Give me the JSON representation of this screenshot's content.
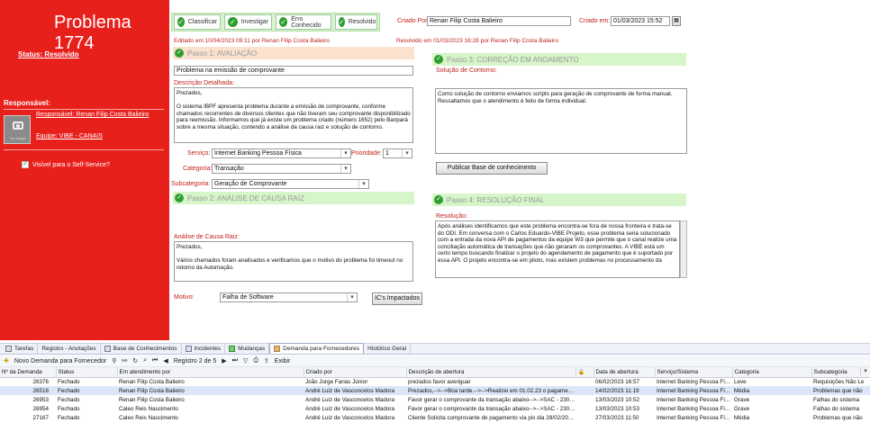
{
  "sidebar": {
    "title": "Problema 1774",
    "status": "Status: Resolvido",
    "responsavel_heading": "Responsável:",
    "no_image": "No Image",
    "responsavel_link": "Responsável: Renan Filip Costa Balieiro",
    "equipe_link": "Equipe: VIBE - CANAIS",
    "self_service_label": "Visível para o Self-Service?"
  },
  "workflow": {
    "tabs": [
      "Classificar",
      "Investigar",
      "Erro Conhecido",
      "Resolvido"
    ]
  },
  "header": {
    "criado_por_label": "Criado Por:",
    "criado_por_value": "Renan Filip Costa Balieiro",
    "criado_em_label": "Criado em:",
    "criado_em_value": "01/03/2023 15:52",
    "editado": "Editado em 10/04/2023 09:11 por Renan Filip Costa Balieiro",
    "resolvido": "Resolvido em 01/03/2023 16:28  por Renan Filip Costa Balieiro"
  },
  "passo1": {
    "title": "Passo 1: AVALIAÇÃO",
    "resumo": "Problema na emissão de comprovante",
    "descricao_label": "Descrição Detalhada:",
    "descricao": "Prezados,\n\nO sistema IBPF apresenta problema durante a emissão de comprovante, conforme chamados recorrentes de diversos clientes que não tiveram seu comprovante disponibilizado para reemissão. Informamos que já existe um problema criado (número 1652) pelo Banpará sobre a mesma situação, contendo a análise da causa raiz e solução de contorno.",
    "servico_label": "Serviço:",
    "servico_value": "Internet Banking Pessoa Física",
    "prioridade_label": "Prioridade:",
    "prioridade_value": "1",
    "categoria_label": "Categoria:",
    "categoria_value": "Transação",
    "subcategoria_label": "Subcategoria:",
    "subcategoria_value": "Geração de Comprovante"
  },
  "passo2": {
    "title": "Passo 2: ANÁLISE DE CAUSA RAIZ",
    "analise_label": "Análise de Causa Raiz:",
    "analise": "Prezados,\n\nVários chamados foram analisados e verificamos que o motivo do problema foi timeout no retorno da Automação.",
    "motivo_label": "Motivo:",
    "motivo_value": "Falha de Software",
    "ics_button": "IC's Impactados"
  },
  "passo3": {
    "title": "Passo 3: CORREÇÃO EM ANDAMENTO",
    "contorno_label": "Solução de Contorno:",
    "contorno": "Como solução de contorno enviamos scripts para geração de comprovante de forma manual. Ressaltamos que o atendimento é feito de forma individual.",
    "publicar_button": "Publicar Base de conhecimento"
  },
  "passo4": {
    "title": "Passo 4: RESOLUÇÃO FINAL",
    "resolucao_label": "Resolução:",
    "resolucao": "Após análises identificamos que este problema encontra-se fora de nossa fronteira e trata-se do ODI. Em conversa com o Carlos Eduardo-VIBE Projeto, esse problema seria solucionado com a entrada da nova API de pagamentos da equipe W3 que permite que o canal realize uma conciliação automática de transações que não geraram os comprovantes. A VIBE está um certo tempo buscando finalizar o projeto do agendamento de pagamento que é suportado por essa API. O projeto encontra-se em piloto, mas existem problemas no processamento da"
  },
  "bottom_tabs": [
    "Tarefas",
    "Registro - Anotações",
    "Base de Conhecimentos",
    "Incidentes",
    "Mudanças",
    "Demanda para Fornecedores",
    "Histórico Geral"
  ],
  "toolbar": {
    "new_label": "Novo Demanda para Fornecedor",
    "record_label": "Registro 2 de 5",
    "exibir_label": "Exibir"
  },
  "grid": {
    "columns": [
      "Nº da Demanda",
      "Status",
      "Em atendimento por",
      "Criado por",
      "Descrição de abertura",
      "",
      "Data de abertura",
      "Serviço/Sistema",
      "Categoria",
      "Subcategoria"
    ],
    "rows": [
      [
        "26376",
        "Fechado",
        "Renan Filip Costa Balieiro",
        "João Jorge Farias Júnior",
        "prezados favor averiguar",
        "",
        "06/02/2023 16:57",
        "Internet Banking Pessoa Fí...",
        "Leve",
        "Requisições Não Le"
      ],
      [
        "26518",
        "Fechado",
        "Renan Filip Costa Balieiro",
        "André Luiz de Vasconcelos Madora",
        "Prezados,-->-->Boa tarde.-->-->Realizei em 01.02.23 o pagamento d...",
        "",
        "14/02/2023 11:19",
        "Internet Banking Pessoa Fí...",
        "Média",
        "Problemas que não"
      ],
      [
        "26953",
        "Fechado",
        "Renan Filip Costa Balieiro",
        "André Luiz de Vasconcelos Madora",
        "Favor gerar o comprovante da transação abaixo-->-->SAC - 2303100...",
        "",
        "13/03/2023 10:52",
        "Internet Banking Pessoa Fí...",
        "Grave",
        "Falhas do sistema"
      ],
      [
        "26954",
        "Fechado",
        "Caleo Reis Nascimento",
        "André Luiz de Vasconcelos Madora",
        "Favor gerar o comprovante da transação abaixo-->-->SAC - 2303100...",
        "",
        "13/03/2023 10:53",
        "Internet Banking Pessoa Fí...",
        "Grave",
        "Falhas do sistema"
      ],
      [
        "27167",
        "Fechado",
        "Caleo Reis Nascimento",
        "André Luiz de Vasconcelos Madora",
        "Cliente Solicita comprovante de pagamento via pix dia 28/02/2023. o...",
        "",
        "27/03/2023 11:50",
        "Internet Banking Pessoa Fí...",
        "Média",
        "Problemas que não"
      ]
    ]
  }
}
